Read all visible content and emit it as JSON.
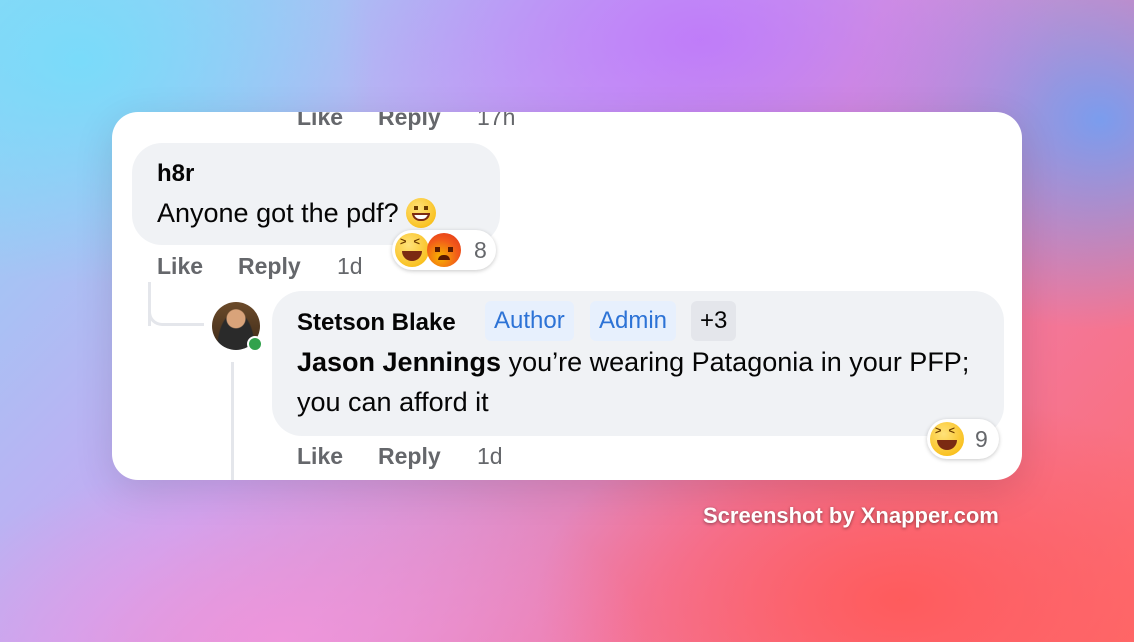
{
  "thread": {
    "top_meta": {
      "like": "Like",
      "reply": "Reply",
      "time": "17h"
    },
    "comments": [
      {
        "author": "h8r",
        "text": "Anyone got the pdf?",
        "text_emoji": "grinning-face-icon",
        "reactions": {
          "icons": [
            "laughing-face-icon",
            "angry-face-icon"
          ],
          "count": "8"
        },
        "meta": {
          "like": "Like",
          "reply": "Reply",
          "time": "1d"
        }
      },
      {
        "author": "Stetson Blake",
        "badges": [
          "Author",
          "Admin",
          "+3"
        ],
        "mention": "Jason Jennings",
        "text": " you’re wearing Patagonia in your PFP; you can afford it",
        "online": true,
        "reactions": {
          "icons": [
            "laughing-face-icon"
          ],
          "count": "9"
        },
        "meta": {
          "like": "Like",
          "reply": "Reply",
          "time": "1d"
        }
      }
    ]
  },
  "watermark": "Screenshot by Xnapper.com",
  "colors": {
    "badge_blue": "#2d73d6",
    "online_green": "#31a24c",
    "bubble": "#f0f2f5"
  }
}
